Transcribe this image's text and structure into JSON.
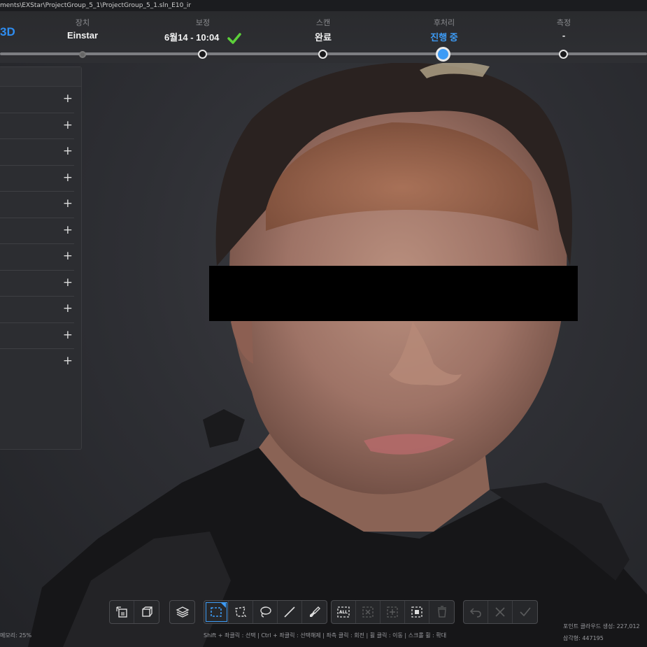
{
  "title_path": "ments\\EXStar\\ProjectGroup_5_1\\ProjectGroup_5_1.sln_E10_ir",
  "brand": "3D",
  "steps": [
    {
      "label": "장치",
      "value": "Einstar"
    },
    {
      "label": "보정",
      "value": "6월14 - 10:04"
    },
    {
      "label": "스캔",
      "value": "완료"
    },
    {
      "label": "후처리",
      "value": "진행 중"
    },
    {
      "label": "측정",
      "value": "-"
    }
  ],
  "left_panel": {
    "rows": [
      "+",
      "+",
      "+",
      "+",
      "+",
      "+",
      "+",
      "+",
      "+",
      "+",
      "+"
    ]
  },
  "toolbar": {
    "groups": [
      {
        "buttons": [
          "view-front-icon",
          "view-cube-icon"
        ]
      },
      {
        "buttons": [
          "layers-icon"
        ]
      },
      {
        "buttons": [
          "rect-select-icon",
          "polygon-select-icon",
          "lasso-select-icon",
          "line-select-icon",
          "brush-select-icon"
        ]
      },
      {
        "buttons": [
          "select-all-icon",
          "deselect-icon",
          "invert-select-icon",
          "select-connected-icon",
          "delete-icon"
        ]
      },
      {
        "buttons": [
          "undo-icon",
          "cancel-icon",
          "apply-icon"
        ]
      }
    ],
    "select_all_label": "ALL"
  },
  "hint_text": "Shift + 좌클릭 : 선택 | Ctrl + 좌클릭 : 선택해제 | 좌측 클릭 : 회전 | 휠 클릭 : 이동 | 스크롤 휠 : 확대",
  "bottom_left_text": "메모리: 25%",
  "stats": {
    "point_cloud": "포인트 클라우드 생성: 227,012",
    "count": "삼각형: 447195"
  },
  "colors": {
    "accent": "#3d9bf5",
    "check": "#5cd03a",
    "background": "#2b2c30"
  }
}
